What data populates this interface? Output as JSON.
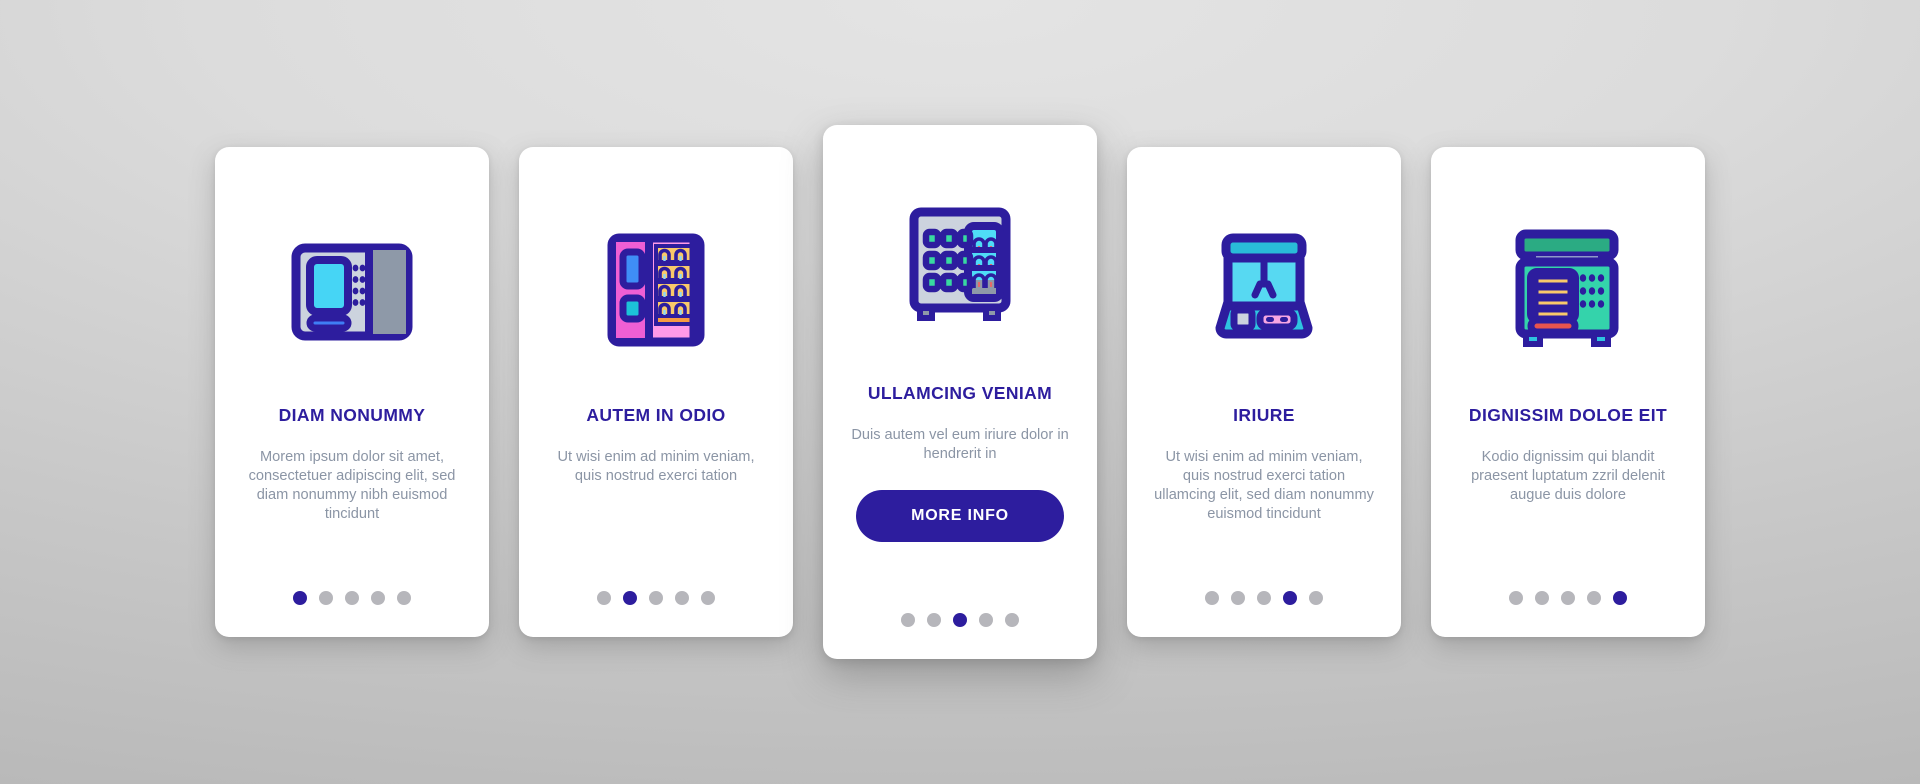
{
  "theme": {
    "accent": "#2d1d9e",
    "title_color": "#2d1d9e",
    "body_color": "#8b95a5",
    "card_bg": "#ffffff",
    "dot_active": "#2d1d9e",
    "dot_inactive": "#b6b6bb",
    "background": "#c9c9c9"
  },
  "cards": [
    {
      "icon_name": "atm-kiosk-icon",
      "title": "DIAM NONUMMY",
      "body": "Morem ipsum dolor sit amet, consectetuer adipiscing elit, sed diam nonummy nibh euismod tincidunt",
      "dots_total": 5,
      "dot_active_index": 0,
      "featured": false,
      "cta_label": ""
    },
    {
      "icon_name": "pink-vending-machine-icon",
      "title": "AUTEM IN ODIO",
      "body": "Ut wisi enim ad minim veniam, quis nostrud exerci tation",
      "dots_total": 5,
      "dot_active_index": 1,
      "featured": false,
      "cta_label": ""
    },
    {
      "icon_name": "drinks-vending-machine-icon",
      "title": "ULLAMCING VENIAM",
      "body": "Duis autem vel eum iriure dolor in hendrerit in",
      "dots_total": 5,
      "dot_active_index": 2,
      "featured": true,
      "cta_label": "MORE INFO"
    },
    {
      "icon_name": "claw-crane-machine-icon",
      "title": "IRIURE",
      "body": "Ut wisi enim ad minim veniam, quis nostrud exerci tation ullamcing elit, sed diam nonummy euismod tincidunt",
      "dots_total": 5,
      "dot_active_index": 3,
      "featured": false,
      "cta_label": ""
    },
    {
      "icon_name": "green-snack-vending-machine-icon",
      "title": "DIGNISSIM DOLOE EIT",
      "body": "Kodio dignissim qui blandit praesent luptatum zzril delenit augue duis dolore",
      "dots_total": 5,
      "dot_active_index": 4,
      "featured": false,
      "cta_label": ""
    }
  ]
}
